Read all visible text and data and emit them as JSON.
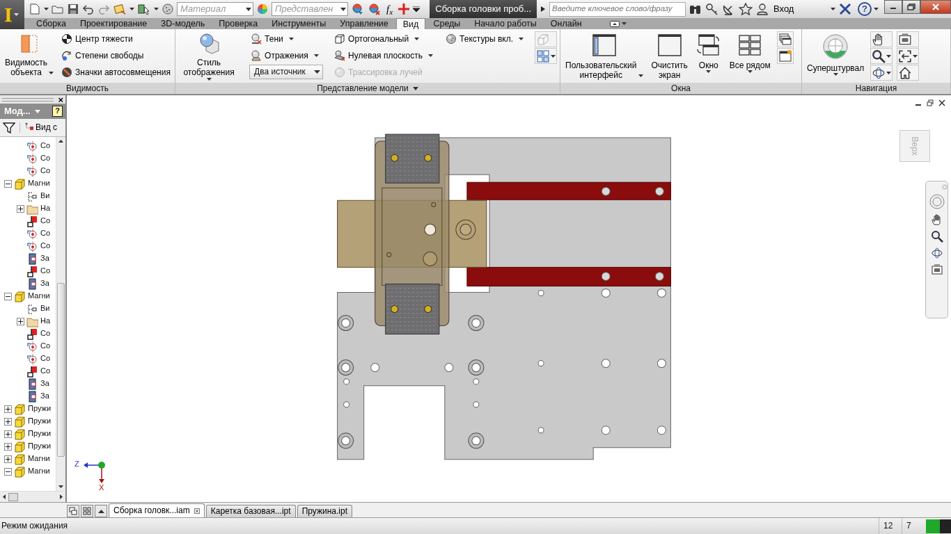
{
  "app_button": {
    "label": "I"
  },
  "quick_access": {
    "material": {
      "placeholder": "Материал"
    },
    "appearance": {
      "placeholder": "Представлен"
    },
    "formula": "f$_{x}$"
  },
  "title": "Сборка головки проб...",
  "search": {
    "placeholder": "Введите ключевое слово/фразу"
  },
  "sign_in": "Вход",
  "help": "?",
  "ribbon_tabs": [
    {
      "label": "Сборка",
      "selected": false
    },
    {
      "label": "Проектирование",
      "selected": false
    },
    {
      "label": "3D-модель",
      "selected": false
    },
    {
      "label": "Проверка",
      "selected": false
    },
    {
      "label": "Инструменты",
      "selected": false
    },
    {
      "label": "Управление",
      "selected": false
    },
    {
      "label": "Вид",
      "selected": true
    },
    {
      "label": "Среды",
      "selected": false
    },
    {
      "label": "Начало работы",
      "selected": false
    },
    {
      "label": "Онлайн",
      "selected": false
    }
  ],
  "ribbon": {
    "panels": [
      {
        "title": "Видимость",
        "menu": false,
        "columns": [
          [
            {
              "kind": "large",
              "label": "Видимость\nобъекта",
              "dropdown": true,
              "disabled": false
            }
          ],
          [
            {
              "kind": "small",
              "label": "Центр тяжести",
              "dropdown": false,
              "disabled": false
            },
            {
              "kind": "small",
              "label": "Степени свободы",
              "dropdown": false,
              "disabled": false
            },
            {
              "kind": "small",
              "label": "Значки автосовмещения",
              "dropdown": false,
              "disabled": false
            }
          ]
        ]
      },
      {
        "title": "Представление модели",
        "menu": true,
        "columns": [
          [
            {
              "kind": "large",
              "label": "Стиль отображения",
              "dropdown": true,
              "disabled": false
            }
          ],
          [
            {
              "kind": "small",
              "label": "Тени",
              "dropdown": true,
              "disabled": false
            },
            {
              "kind": "small",
              "label": "Отражения",
              "dropdown": true,
              "disabled": false
            },
            {
              "kind": "combo",
              "value": "Два источник",
              "disabled": false
            }
          ],
          [
            {
              "kind": "small",
              "label": "Ортогональный",
              "dropdown": true,
              "disabled": false
            },
            {
              "kind": "small",
              "label": "Нулевая плоскость",
              "dropdown": true,
              "disabled": false
            },
            {
              "kind": "small",
              "label": "Трассировка лучей",
              "dropdown": false,
              "disabled": true
            }
          ],
          [
            {
              "kind": "small",
              "label": "Текстуры вкл.",
              "dropdown": true,
              "disabled": false
            }
          ],
          [
            {
              "kind": "icon",
              "dropdown": false,
              "disabled": true
            },
            {
              "kind": "icon",
              "dropdown": true,
              "disabled": false
            }
          ]
        ]
      },
      {
        "title": "Окна",
        "menu": false,
        "columns": [
          [
            {
              "kind": "large",
              "label": "Пользовательский\nинтерфейс",
              "dropdown": true,
              "disabled": false
            }
          ],
          [
            {
              "kind": "large",
              "label": "Очистить\nэкран",
              "dropdown": false,
              "disabled": false
            }
          ],
          [
            {
              "kind": "large",
              "label": "Окно",
              "dropdown": true,
              "disabled": false
            }
          ],
          [
            {
              "kind": "large",
              "label": "Все рядом",
              "dropdown": true,
              "disabled": false
            }
          ],
          [
            {
              "kind": "icon",
              "dropdown": false,
              "disabled": false
            },
            {
              "kind": "icon",
              "dropdown": false,
              "disabled": false
            }
          ]
        ]
      },
      {
        "title": "Навигация",
        "menu": false,
        "columns": [
          [
            {
              "kind": "large",
              "label": "Суперштурвал",
              "dropdown": true,
              "disabled": false
            }
          ],
          [
            {
              "kind": "icon",
              "dropdown": false,
              "disabled": false
            },
            {
              "kind": "icon",
              "dropdown": true,
              "disabled": false
            },
            {
              "kind": "icon",
              "dropdown": true,
              "disabled": false
            }
          ],
          [
            {
              "kind": "icon",
              "dropdown": false,
              "disabled": false
            },
            {
              "kind": "icon",
              "dropdown": true,
              "disabled": false
            },
            {
              "kind": "icon",
              "dropdown": false,
              "disabled": false
            }
          ]
        ]
      }
    ]
  },
  "browser": {
    "close": "×",
    "title": "Мод...",
    "help": "?",
    "view_label": "Вид с",
    "tree": {
      "continued_children": [
        {
          "kind": "insert",
          "label": "Со"
        },
        {
          "kind": "insert",
          "label": "Со"
        },
        {
          "kind": "insert",
          "label": "Со"
        }
      ],
      "items": [
        {
          "kind": "component",
          "label": "Магни",
          "expanded": true,
          "children": [
            {
              "kind": "representations",
              "label": "Ви"
            },
            {
              "kind": "folder",
              "label": "На",
              "expanded": false
            },
            {
              "kind": "mate",
              "label": "Со"
            },
            {
              "kind": "insert",
              "label": "Со"
            },
            {
              "kind": "insert",
              "label": "Со"
            },
            {
              "kind": "flush",
              "label": "За"
            },
            {
              "kind": "mate",
              "label": "Со"
            },
            {
              "kind": "flush",
              "label": "За"
            }
          ]
        },
        {
          "kind": "component",
          "label": "Магни",
          "expanded": true,
          "children": [
            {
              "kind": "representations",
              "label": "Ви"
            },
            {
              "kind": "folder",
              "label": "На",
              "expanded": false
            },
            {
              "kind": "mate",
              "label": "Со"
            },
            {
              "kind": "insert",
              "label": "Со"
            },
            {
              "kind": "insert",
              "label": "Со"
            },
            {
              "kind": "mate",
              "label": "Со"
            },
            {
              "kind": "flush",
              "label": "За"
            },
            {
              "kind": "flush",
              "label": "За"
            }
          ]
        },
        {
          "kind": "component",
          "label": "Пружи",
          "expanded": false
        },
        {
          "kind": "component",
          "label": "Пружи",
          "expanded": false
        },
        {
          "kind": "component",
          "label": "Пружи",
          "expanded": false
        },
        {
          "kind": "component",
          "label": "Пружи",
          "expanded": false
        },
        {
          "kind": "component",
          "label": "Магни",
          "expanded": false
        },
        {
          "kind": "component",
          "label": "Магни",
          "expanded": true
        }
      ]
    }
  },
  "viewport": {
    "view_cube": "Верх",
    "triad": {
      "z": "Z",
      "x": "X"
    }
  },
  "document_tabs": [
    {
      "label": "Сборка головк...iam",
      "selected": true,
      "closable": true
    },
    {
      "label": "Каретка базовая...ipt",
      "selected": false,
      "closable": false
    },
    {
      "label": "Пружина.ipt",
      "selected": false,
      "closable": false
    }
  ],
  "status_bar": {
    "message": "Режим ожидания",
    "values": [
      "12",
      "7"
    ]
  }
}
